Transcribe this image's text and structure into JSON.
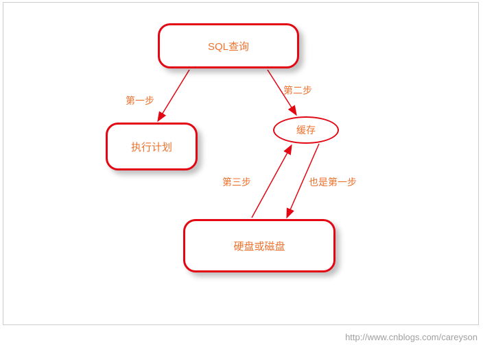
{
  "diagram": {
    "nodes": {
      "sql": {
        "label": "SQL查询",
        "shape": "rounded-rect"
      },
      "plan": {
        "label": "执行计划",
        "shape": "rounded-rect"
      },
      "cache": {
        "label": "缓存",
        "shape": "ellipse"
      },
      "disk": {
        "label": "硬盘或磁盘",
        "shape": "rounded-rect"
      }
    },
    "edges": {
      "sql_to_plan": {
        "from": "sql",
        "to": "plan",
        "label": "第一步"
      },
      "sql_to_cache": {
        "from": "sql",
        "to": "cache",
        "label": "第二步"
      },
      "disk_to_cache": {
        "from": "disk",
        "to": "cache",
        "label": "第三步"
      },
      "cache_to_disk": {
        "from": "cache",
        "to": "disk",
        "label": "也是第一步"
      }
    },
    "watermark": "http://www.cnblogs.com/careyson",
    "colors": {
      "node_border": "#e30613",
      "text": "#ec722e",
      "arrow": "#e30613"
    }
  }
}
